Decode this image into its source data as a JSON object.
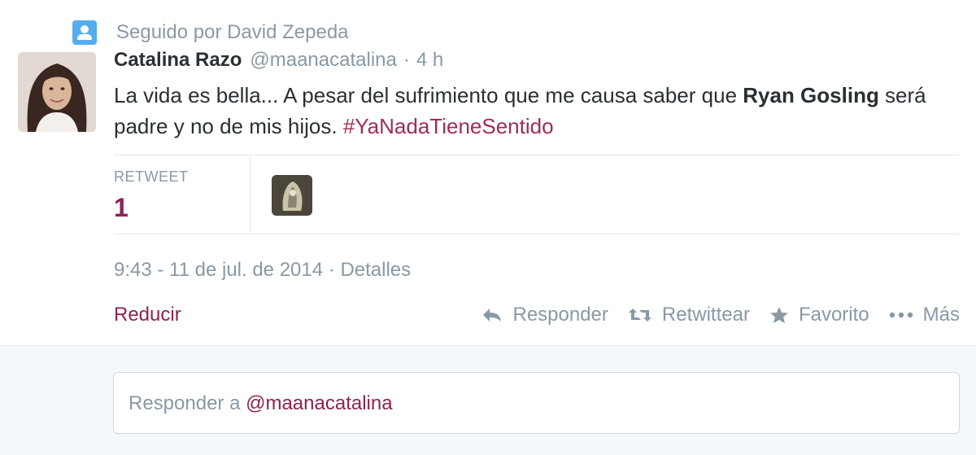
{
  "context": {
    "icon": "user-follow-icon",
    "text": "Seguido por David Zepeda"
  },
  "author": {
    "fullname": "Catalina Razo",
    "username": "@maanacatalina",
    "separator": "·",
    "time": "4 h"
  },
  "tweet": {
    "text_part1": "La vida es bella... A pesar del sufrimiento que me causa saber que ",
    "bold": "Ryan Gosling",
    "text_part2": " será padre y no de mis hijos. ",
    "hashtag": "#YaNadaTieneSentido"
  },
  "stats": {
    "label": "RETWEET",
    "value": "1"
  },
  "timestamp": {
    "date": "9:43 - 11 de jul. de 2014",
    "separator": "·",
    "details": "Detalles"
  },
  "actions": {
    "collapse": "Reducir",
    "reply": "Responder",
    "retweet": "Retwittear",
    "favorite": "Favorito",
    "more": "Más"
  },
  "reply_box": {
    "prefix": "Responder a ",
    "mention": "@maanacatalina"
  },
  "colors": {
    "accent": "#8c2351",
    "muted": "#8899a6",
    "text": "#292f33",
    "context_icon": "#55acee"
  }
}
